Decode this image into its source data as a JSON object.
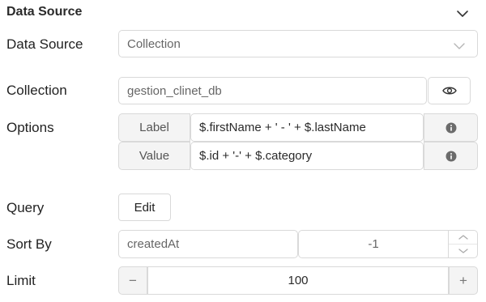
{
  "section": {
    "title": "Data Source"
  },
  "data_source": {
    "label": "Data Source",
    "value": "Collection"
  },
  "collection": {
    "label": "Collection",
    "value": "gestion_clinet_db"
  },
  "options": {
    "label": "Options",
    "label_addon": "Label",
    "label_value": "$.firstName + ' - ' + $.lastName",
    "value_addon": "Value",
    "value_value": "$.id + '-' + $.category"
  },
  "query": {
    "label": "Query",
    "button": "Edit"
  },
  "sort_by": {
    "label": "Sort By",
    "field": "createdAt",
    "direction": "-1"
  },
  "limit": {
    "label": "Limit",
    "value": "100",
    "minus": "−",
    "plus": "+"
  },
  "icons": {
    "section_chevron": "chevron-down-icon",
    "select_chevron": "chevron-down-icon",
    "toggle_visibility": "eye-icon",
    "info": "info-icon",
    "stepper_up": "chevron-up-icon",
    "stepper_down": "chevron-down-icon"
  },
  "colors": {
    "border": "#d9d9d9",
    "addon_bg": "#f4f4f4",
    "text": "#222222"
  }
}
